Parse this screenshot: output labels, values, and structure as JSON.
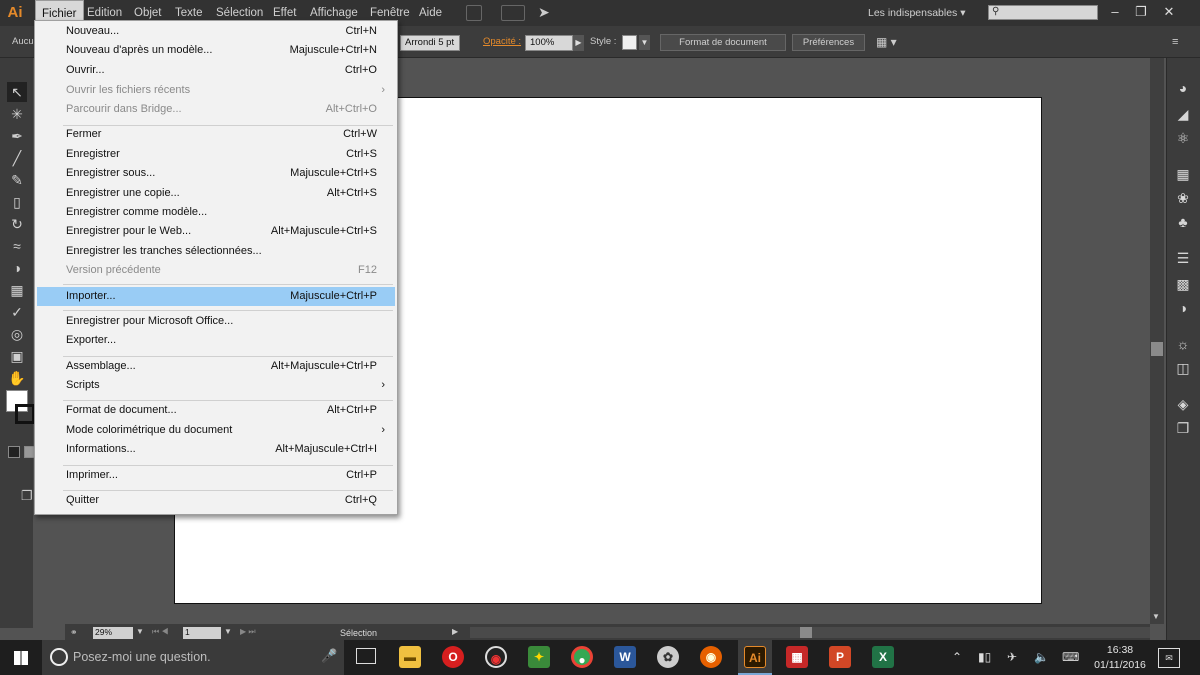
{
  "menubar": {
    "logo": "Ai",
    "items": [
      "Fichier",
      "Edition",
      "Objet",
      "Texte",
      "Sélection",
      "Effet",
      "Affichage",
      "Fenêtre",
      "Aide"
    ],
    "workspace": "Les indispensables"
  },
  "controlbar": {
    "fill_label": "Aucu",
    "brush": "Arrondi 5 pt",
    "opacity_label": "Opacité :",
    "opacity_value": "100%",
    "style_label": "Style :",
    "doc_format_button": "Format de document",
    "preferences_button": "Préférences"
  },
  "filemenu": {
    "items": [
      {
        "label": "Nouveau...",
        "shortcut": "Ctrl+N",
        "disabled": false
      },
      {
        "label": "Nouveau d'après un modèle...",
        "shortcut": "Majuscule+Ctrl+N",
        "disabled": false
      },
      {
        "label": "Ouvrir...",
        "shortcut": "Ctrl+O",
        "disabled": false
      },
      {
        "label": "Ouvrir les fichiers récents",
        "shortcut": "",
        "submenu": true,
        "disabled": true
      },
      {
        "label": "Parcourir dans Bridge...",
        "shortcut": "Alt+Ctrl+O",
        "disabled": true
      },
      {
        "label": "Fermer",
        "shortcut": "Ctrl+W",
        "disabled": false
      },
      {
        "label": "Enregistrer",
        "shortcut": "Ctrl+S",
        "disabled": false
      },
      {
        "label": "Enregistrer sous...",
        "shortcut": "Majuscule+Ctrl+S",
        "disabled": false
      },
      {
        "label": "Enregistrer une copie...",
        "shortcut": "Alt+Ctrl+S",
        "disabled": false
      },
      {
        "label": "Enregistrer comme modèle...",
        "shortcut": "",
        "disabled": false
      },
      {
        "label": "Enregistrer pour le Web...",
        "shortcut": "Alt+Majuscule+Ctrl+S",
        "disabled": false
      },
      {
        "label": "Enregistrer les tranches sélectionnées...",
        "shortcut": "",
        "disabled": false
      },
      {
        "label": "Version précédente",
        "shortcut": "F12",
        "disabled": true
      },
      {
        "label": "Importer...",
        "shortcut": "Majuscule+Ctrl+P",
        "disabled": false,
        "highlighted": true
      },
      {
        "label": "Enregistrer pour Microsoft Office...",
        "shortcut": "",
        "disabled": false
      },
      {
        "label": "Exporter...",
        "shortcut": "",
        "disabled": false
      },
      {
        "label": "Assemblage...",
        "shortcut": "Alt+Majuscule+Ctrl+P",
        "disabled": false
      },
      {
        "label": "Scripts",
        "shortcut": "",
        "submenu": true,
        "disabled": false
      },
      {
        "label": "Format de document...",
        "shortcut": "Alt+Ctrl+P",
        "disabled": false
      },
      {
        "label": "Mode colorimétrique du document",
        "shortcut": "",
        "submenu": true,
        "disabled": false
      },
      {
        "label": "Informations...",
        "shortcut": "Alt+Majuscule+Ctrl+I",
        "disabled": false
      },
      {
        "label": "Imprimer...",
        "shortcut": "Ctrl+P",
        "disabled": false
      },
      {
        "label": "Quitter",
        "shortcut": "Ctrl+Q",
        "disabled": false
      }
    ]
  },
  "statusbar": {
    "zoom": "29%",
    "page": "1",
    "tool": "Sélection"
  },
  "taskbar": {
    "search_placeholder": "Posez-moi une question.",
    "time": "16:38",
    "date": "01/11/2016"
  },
  "colors": {
    "menu_highlight": "#99ccf5",
    "ai_brand": "#e58a2a",
    "opacity_label": "#e58a2a"
  }
}
